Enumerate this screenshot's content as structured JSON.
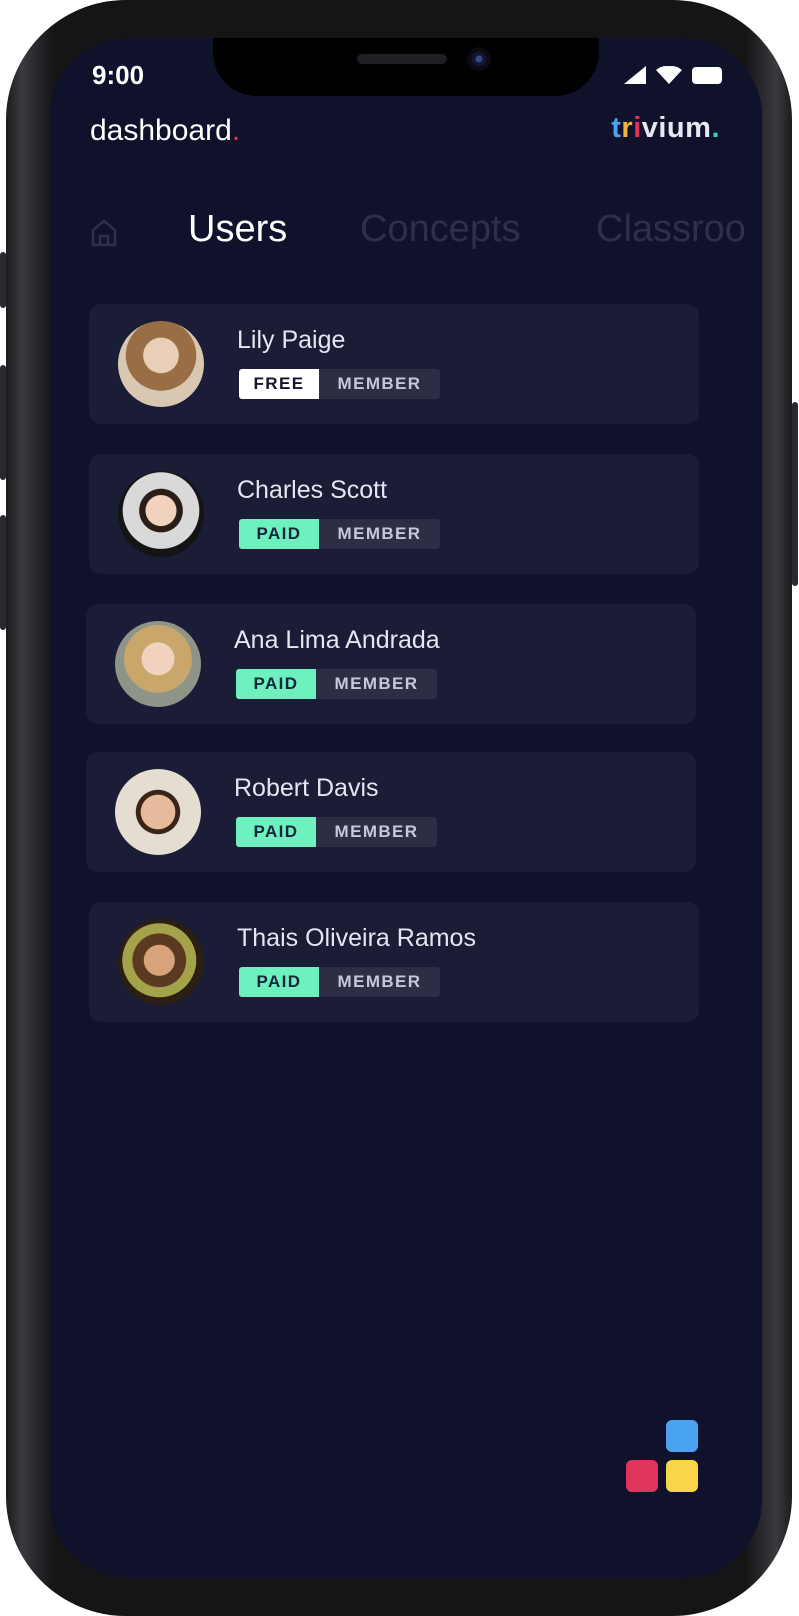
{
  "status_bar": {
    "time": "9:00"
  },
  "header": {
    "title": "dashboard",
    "title_dot": ".",
    "brand_letters": [
      "t",
      "r",
      "i",
      "vium",
      "."
    ],
    "brand_colors": [
      "#4aa3f0",
      "#f3b43c",
      "#e0345a",
      "#2dd4bf"
    ]
  },
  "tabs": [
    {
      "label": "Users",
      "active": true
    },
    {
      "label": "Concepts",
      "active": false
    },
    {
      "label": "Classroo",
      "active": false
    }
  ],
  "users": [
    {
      "name": "Lily Paige",
      "plan": "FREE",
      "role": "MEMBER"
    },
    {
      "name": "Charles Scott",
      "plan": "PAID",
      "role": "MEMBER"
    },
    {
      "name": "Ana Lima Andrada",
      "plan": "PAID",
      "role": "MEMBER"
    },
    {
      "name": "Robert Davis",
      "plan": "PAID",
      "role": "MEMBER"
    },
    {
      "name": "Thais Oliveira Ramos",
      "plan": "PAID",
      "role": "MEMBER"
    }
  ],
  "colors": {
    "background": "#10112b",
    "card": "#1b1c35",
    "paid_badge": "#6ff0bf",
    "free_badge": "#ffffff",
    "member_badge": "#2c2e46",
    "logo_blue": "#4aa3f0",
    "logo_red": "#e0345a",
    "logo_yellow": "#f9d548"
  }
}
